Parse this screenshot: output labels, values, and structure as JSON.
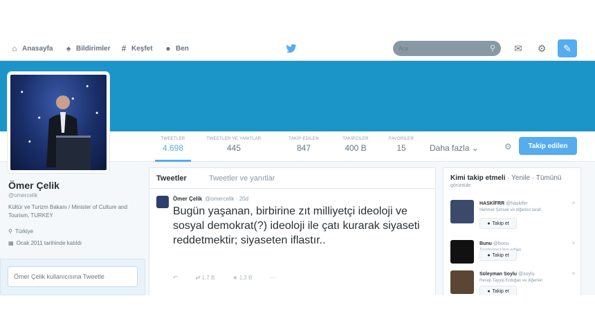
{
  "nav": {
    "home": "Anasayfa",
    "notifications": "Bildirimler",
    "discover": "Keşfet",
    "me": "Ben"
  },
  "search": {
    "placeholder": "Ara"
  },
  "icons": {
    "home": "home-icon",
    "notifications": "bell-icon",
    "discover": "hashtag-icon",
    "me": "user-icon",
    "logo": "twitter-bird-icon",
    "search": "search-icon",
    "messages": "messages-icon",
    "settings": "gear-icon",
    "compose": "compose-icon"
  },
  "colors": {
    "accent": "#55acee",
    "banner": "#1b95c8"
  },
  "stats": [
    {
      "label": "TWEETLER",
      "value": "4.698"
    },
    {
      "label": "TWEETLER VE YANITLAR",
      "value": "445"
    },
    {
      "label": "TAKİP EDİLEN",
      "value": "847"
    },
    {
      "label": "TAKİPÇİLER",
      "value": "400 B"
    },
    {
      "label": "FAVORİLER",
      "value": "15"
    }
  ],
  "more": "Daha fazla",
  "follow_button": "Takip edilen",
  "profile": {
    "name": "Ömer Çelik",
    "handle": "@omercelik",
    "bio": "Kültür ve Turizm Bakanı / Minister of Culture and Tourism, TURKEY",
    "location": "Türkiye",
    "joined": "Ocak 2011 tarihinde katıldı"
  },
  "tweet_box_placeholder": "Ömer Çelik kullanıcısına Tweetle",
  "tabs": {
    "tweets": "Tweetler",
    "replies": "Tweetler ve yanıtlar"
  },
  "tweet": {
    "name": "Ömer Çelik",
    "handle": "@omercelik · 20d",
    "text": "Bugün yaşanan, birbirine zıt milliyetçi ideoloji ve sosyal demokrat(?) ideoloji ile çatı kurarak siyaseti reddetmektir; siyaseten iflastır..",
    "retweets": "1,7 B",
    "favorites": "1,3 B"
  },
  "who_to_follow": {
    "title": "Kimi takip etmeli",
    "refresh": "· Yenile · Tümünü",
    "sub": "görüntüle",
    "follow_label": "Takip et",
    "items": [
      {
        "name": "HASKİFRR",
        "handle": "@haskifirr",
        "line": "Mehmet Şimsek ve diğerleri tarafı"
      },
      {
        "name": "Bunu",
        "handle": "@bunu",
        "line": "Tarafından takip edilen"
      },
      {
        "name": "Süleyman Soylu",
        "handle": "@soylu",
        "line": "Recep Tayyip Erdoğan ve diğerleri"
      }
    ]
  }
}
